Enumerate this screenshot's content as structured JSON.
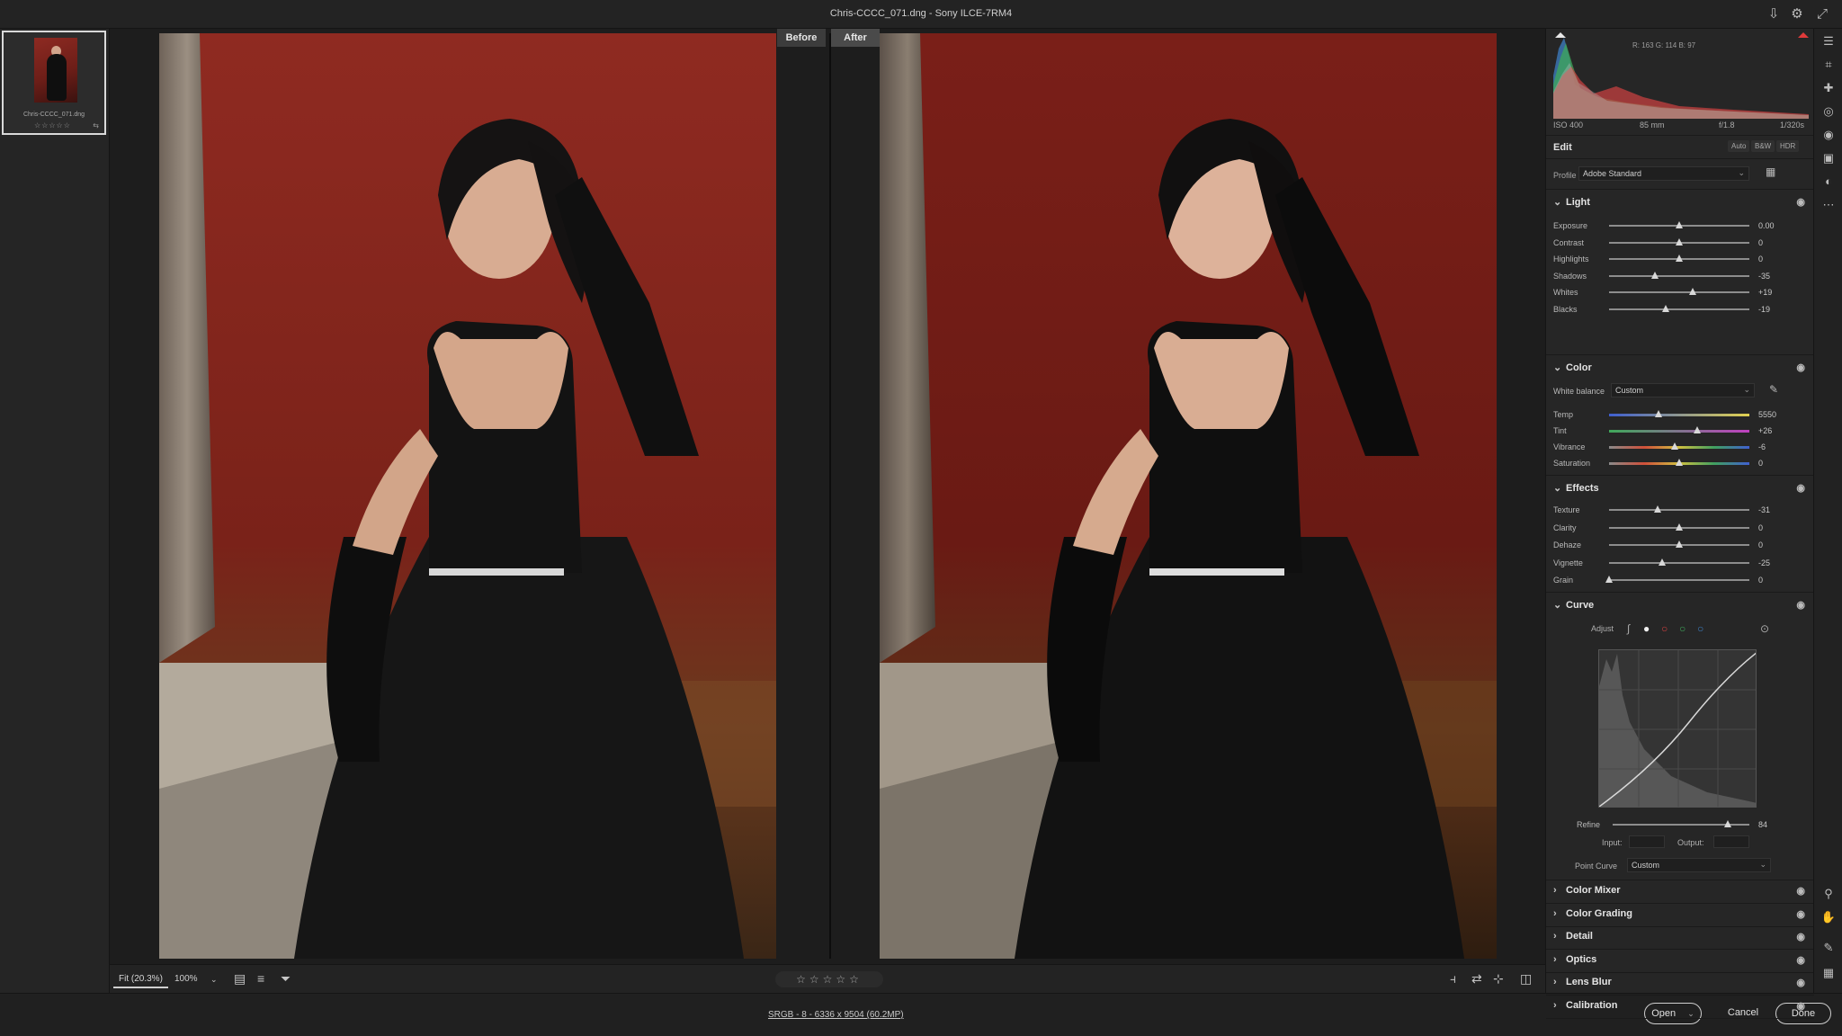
{
  "window": {
    "title": "Chris-CCCC_071.dng  -  Sony ILCE-7RM4"
  },
  "filmstrip": {
    "thumb_name": "Chris-CCCC_071.dng",
    "stars": "☆☆☆☆☆",
    "badge": "⇆"
  },
  "compare": {
    "before_label": "Before",
    "after_label": "After"
  },
  "bottom": {
    "fit_label": "Fit (20.3%)",
    "zoom_label": "100%",
    "rating": "☆☆☆☆☆"
  },
  "status": {
    "image_info": "SRGB - 8 - 6336 x 9504 (60.2MP)",
    "open_label": "Open",
    "cancel_label": "Cancel",
    "done_label": "Done"
  },
  "histogram": {
    "readout": "R: 163   G: 114   B: 97"
  },
  "meta": {
    "iso": "ISO 400",
    "focal": "85 mm",
    "aperture": "f/1.8",
    "shutter": "1/320s"
  },
  "edit": {
    "title": "Edit",
    "auto_label": "Auto",
    "bw_label": "B&W",
    "hdr_label": "HDR",
    "profile_label": "Profile",
    "profile_value": "Adobe Standard"
  },
  "light": {
    "title": "Light",
    "sliders": [
      {
        "label": "Exposure",
        "value": "0.00",
        "level": 0.5
      },
      {
        "label": "Contrast",
        "value": "0",
        "level": 0.5
      },
      {
        "label": "Highlights",
        "value": "0",
        "level": 0.5
      },
      {
        "label": "Shadows",
        "value": "-35",
        "level": 0.325
      },
      {
        "label": "Whites",
        "value": "+19",
        "level": 0.595
      },
      {
        "label": "Blacks",
        "value": "-19",
        "level": 0.405
      }
    ]
  },
  "color": {
    "title": "Color",
    "wb_label": "White balance",
    "wb_value": "Custom",
    "sliders": [
      {
        "label": "Temp",
        "value": "5550",
        "level": 0.35
      },
      {
        "label": "Tint",
        "value": "+26",
        "level": 0.63
      },
      {
        "label": "Vibrance",
        "value": "-6",
        "level": 0.47
      },
      {
        "label": "Saturation",
        "value": "0",
        "level": 0.5
      }
    ]
  },
  "effects": {
    "title": "Effects",
    "sliders": [
      {
        "label": "Texture",
        "value": "-31",
        "level": 0.345
      },
      {
        "label": "Clarity",
        "value": "0",
        "level": 0.5
      },
      {
        "label": "Dehaze",
        "value": "0",
        "level": 0.5
      },
      {
        "label": "Vignette",
        "value": "-25",
        "level": 0.375
      },
      {
        "label": "Grain",
        "value": "0",
        "level": 0.0
      }
    ]
  },
  "curve": {
    "title": "Curve",
    "adjust_label": "Adjust",
    "refine_label": "Refine",
    "refine_value": "84",
    "refine_level": 0.84,
    "input_label": "Input:",
    "output_label": "Output:",
    "point_curve_label": "Point Curve",
    "point_curve_value": "Custom"
  },
  "collapsed_sections": [
    {
      "title": "Color Mixer"
    },
    {
      "title": "Color Grading"
    },
    {
      "title": "Detail"
    },
    {
      "title": "Optics"
    },
    {
      "title": "Lens Blur"
    },
    {
      "title": "Calibration"
    }
  ],
  "colors": {
    "accent": "#d9d9d9",
    "clip_warning": "#e03a3a",
    "backdrop_red": "#8e2a22"
  }
}
